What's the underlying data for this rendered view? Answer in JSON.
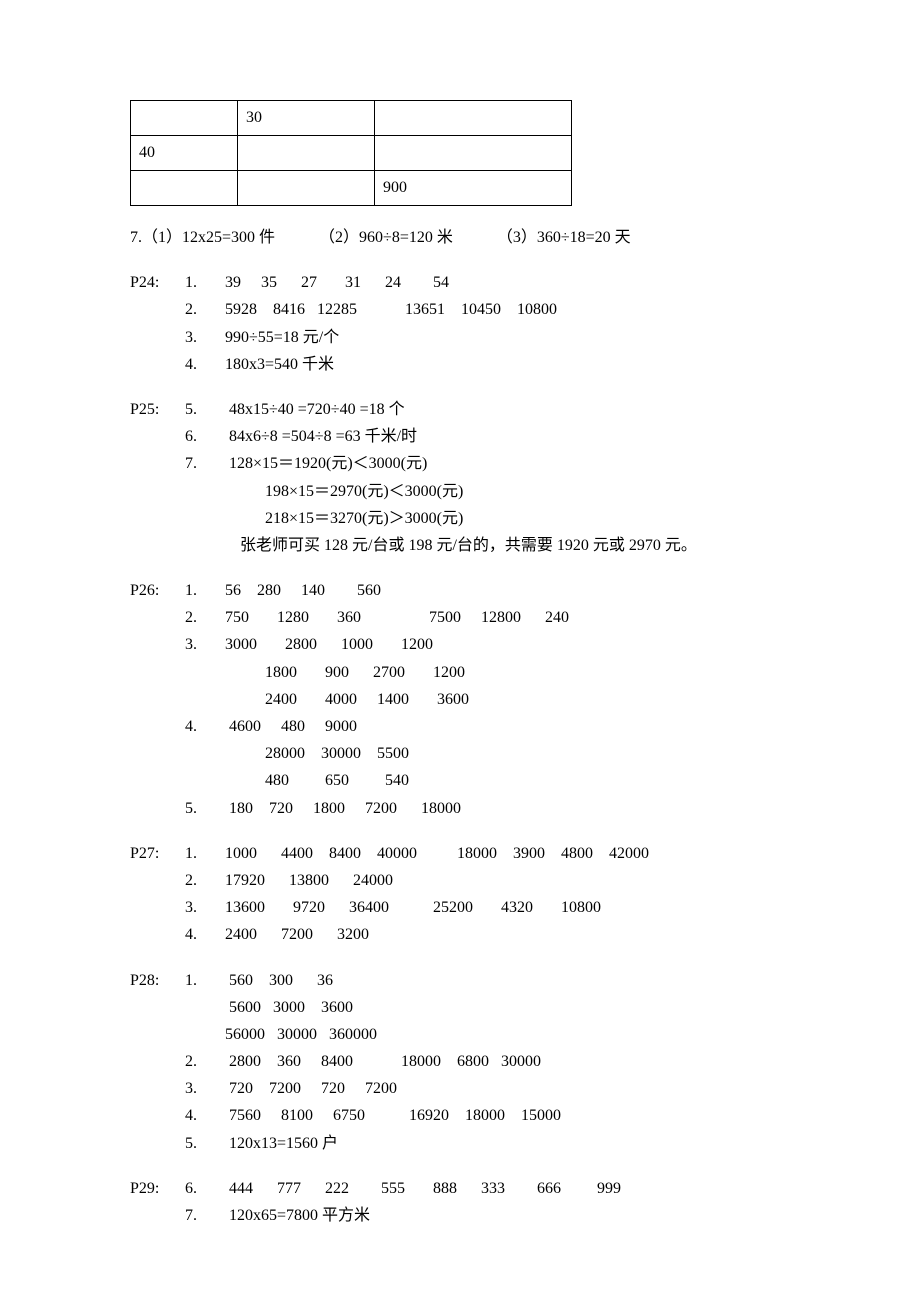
{
  "table": {
    "r0c0": "",
    "r0c1": "30",
    "r0c2": "",
    "r1c0": "40",
    "r1c1": "",
    "r1c2": "",
    "r2c0": "",
    "r2c1": "",
    "r2c2": "900"
  },
  "q7": {
    "part1": "7.（1）12x25=300 件",
    "part2": "（2）960÷8=120 米",
    "part3": "（3）360÷18=20 天"
  },
  "p24": {
    "label": "P24:",
    "l1": {
      "n": "1.",
      "v": "39     35      27       31      24        54"
    },
    "l2": {
      "n": "2.",
      "v": "5928    8416   12285            13651    10450    10800"
    },
    "l3": {
      "n": "3.",
      "v": "990÷55=18 元/个"
    },
    "l4": {
      "n": "4.",
      "v": "180x3=540 千米"
    }
  },
  "p25": {
    "label": "P25:",
    "l5": {
      "n": "5.",
      "v": " 48x15÷40 =720÷40 =18 个"
    },
    "l6": {
      "n": "6.",
      "v": " 84x6÷8 =504÷8 =63 千米/时"
    },
    "l7": {
      "n": "7.",
      "v": " 128×15＝1920(元)＜3000(元)"
    },
    "l7b": "198×15＝2970(元)＜3000(元)",
    "l7c": "218×15＝3270(元)＞3000(元)",
    "l7d": "张老师可买 128 元/台或 198 元/台的，共需要 1920 元或 2970 元。"
  },
  "p26": {
    "label": "P26:",
    "l1": {
      "n": "1.",
      "v": "56    280     140        560"
    },
    "l2": {
      "n": "2.",
      "v": "750       1280       360                 7500     12800      240"
    },
    "l3": {
      "n": "3.",
      "v": "3000       2800      1000       1200"
    },
    "l3b": "1800       900      2700       1200",
    "l3c": "2400       4000     1400       3600",
    "l4": {
      "n": "4.",
      "v": " 4600     480     9000"
    },
    "l4b": "28000    30000    5500",
    "l4c": "480         650         540",
    "l5": {
      "n": "5.",
      "v": " 180    720     1800     7200      18000"
    }
  },
  "p27": {
    "label": "P27:",
    "l1": {
      "n": "1.",
      "v": "1000      4400    8400    40000          18000    3900    4800    42000"
    },
    "l2": {
      "n": "2.",
      "v": "17920      13800      24000"
    },
    "l3": {
      "n": "3.",
      "v": "13600       9720      36400           25200       4320       10800"
    },
    "l4": {
      "n": "4.",
      "v": "2400      7200      3200"
    }
  },
  "p28": {
    "label": "P28:",
    "l1": {
      "n": "1.",
      "v": " 560    300      36"
    },
    "l1b": " 5600   3000    3600",
    "l1c": "56000   30000   360000",
    "l2": {
      "n": "2.",
      "v": " 2800    360     8400            18000    6800   30000"
    },
    "l3": {
      "n": "3.",
      "v": " 720    7200     720     7200"
    },
    "l4": {
      "n": "4.",
      "v": " 7560     8100     6750           16920    18000    15000"
    },
    "l5": {
      "n": "5.",
      "v": " 120x13=1560 户"
    }
  },
  "p29": {
    "label": "P29:",
    "l6": {
      "n": "6.",
      "v": " 444      777      222        555       888      333        666         999"
    },
    "l7": {
      "n": "7.",
      "v": " 120x65=7800 平方米"
    }
  }
}
